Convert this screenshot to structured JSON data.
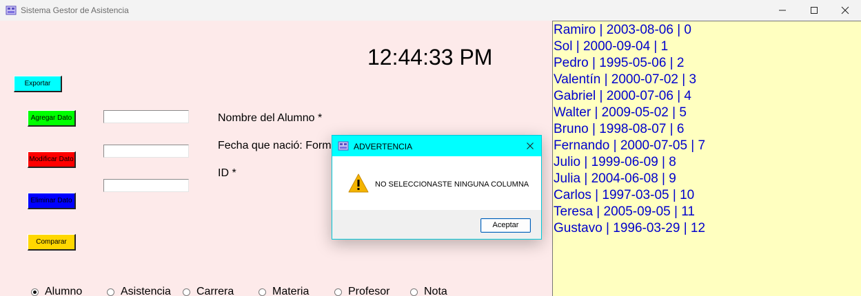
{
  "window": {
    "title": "Sistema Gestor de Asistencia",
    "icon": "app-icon",
    "controls": {
      "minimize_icon": "minimize-icon",
      "maximize_icon": "maximize-icon",
      "close_icon": "close-icon"
    }
  },
  "clock": "12:44:33 PM",
  "buttons": {
    "export": "Exportar",
    "add": "Agregar Dato",
    "modify": "Modificar Dato",
    "delete": "Eliminar Dato",
    "compare": "Comparar"
  },
  "inputs": {
    "name": {
      "value": "",
      "placeholder": ""
    },
    "birthdate": {
      "value": "",
      "placeholder": ""
    },
    "id": {
      "value": "",
      "placeholder": ""
    }
  },
  "labels": {
    "name": "Nombre del Alumno *",
    "birthdate": "Fecha que nació: Formato YYYY-MM-DD *",
    "id": "ID *"
  },
  "radios": [
    {
      "label": "Alumno",
      "selected": true
    },
    {
      "label": "Asistencia",
      "selected": false
    },
    {
      "label": "Carrera",
      "selected": false
    },
    {
      "label": "Materia",
      "selected": false
    },
    {
      "label": "Profesor",
      "selected": false
    },
    {
      "label": "Nota",
      "selected": false
    }
  ],
  "records": [
    "Ramiro | 2003-08-06 | 0",
    "Sol | 2000-09-04 | 1",
    "Pedro | 1995-05-06 | 2",
    "Valentín | 2000-07-02 | 3",
    "Gabriel | 2000-07-06 | 4",
    "Walter | 2009-05-02 | 5",
    "Bruno | 1998-08-07 | 6",
    "Fernando | 2000-07-05 | 7",
    "Julio | 1999-06-09 | 8",
    "Julia | 2004-06-08 | 9",
    "Carlos | 1997-03-05 | 10",
    "Teresa | 2005-09-05 | 11",
    "Gustavo | 1996-03-29 | 12"
  ],
  "dialog": {
    "title": "ADVERTENCIA",
    "message": "NO SELECCIONASTE NINGUNA COLUMNA",
    "ok": "Aceptar",
    "icon": "warning-icon"
  },
  "colors": {
    "export": "#00ffff",
    "add": "#00ff00",
    "modify": "#ff0000",
    "delete": "#0000ff",
    "compare": "#ffd700",
    "main_bg": "#fdeaea",
    "list_bg": "#ffffc0",
    "list_text": "#0000cc",
    "dialog_title_bg": "#00ffff"
  }
}
